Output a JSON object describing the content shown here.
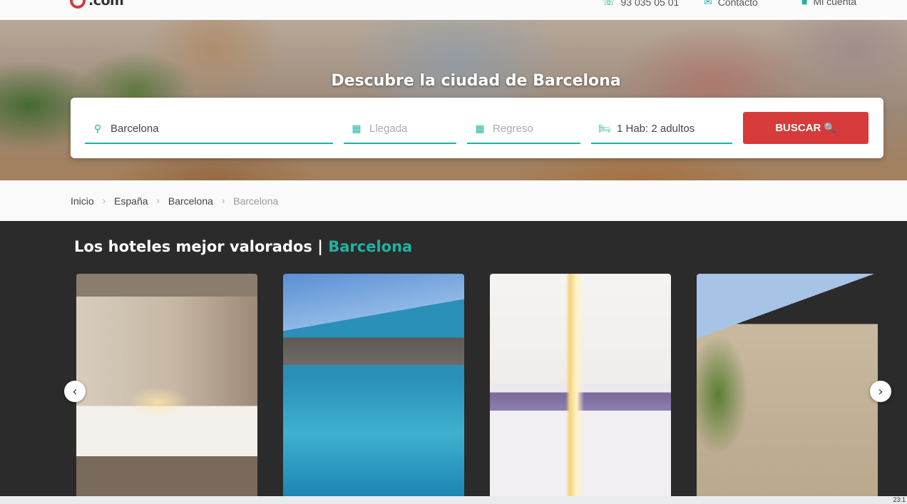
{
  "header": {
    "logo_text": ".com",
    "phone": "93 035 05 01",
    "contact": "Contacto",
    "account": "Mi cuenta"
  },
  "hero": {
    "title": "Descubre la ciudad de Barcelona"
  },
  "search": {
    "destination": "Barcelona",
    "checkin_placeholder": "Llegada",
    "checkout_placeholder": "Regreso",
    "rooms": "1 Hab: 2 adultos",
    "button_label": "BUSCAR"
  },
  "breadcrumb": [
    "Inicio",
    "España",
    "Barcelona",
    "Barcelona"
  ],
  "section": {
    "title": "Los hoteles mejor valorados |",
    "title_accent": "Barcelona"
  },
  "taskbar": {
    "clock": "23:1"
  },
  "colors": {
    "accent": "#1fb3a0",
    "button": "#d63a3a",
    "section_bg": "#2b2b2b"
  }
}
